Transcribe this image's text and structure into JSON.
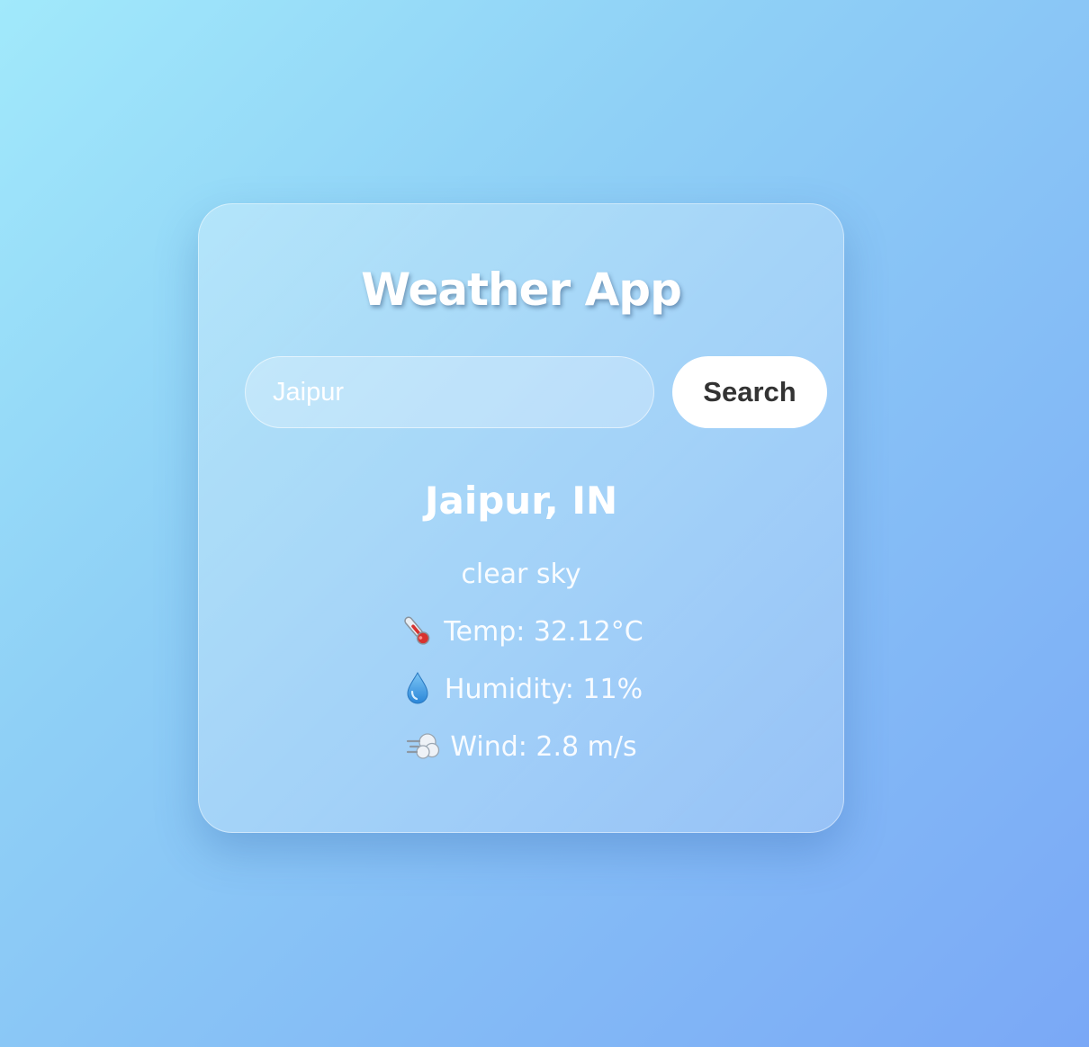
{
  "app": {
    "title": "Weather App"
  },
  "search": {
    "value": "Jaipur",
    "button_label": "Search"
  },
  "weather": {
    "location": "Jaipur, IN",
    "description": "clear sky",
    "temp_label": "Temp: 32.12°C",
    "humidity_label": "Humidity: 11%",
    "wind_label": "Wind: 2.8 m/s",
    "icons": {
      "temp": "thermometer-icon",
      "humidity": "droplet-icon",
      "wind": "wind-icon"
    }
  },
  "colors": {
    "background_start": "#a1e9fb",
    "background_end": "#7aa8f6",
    "button_bg": "#ffffff",
    "button_text": "#333333",
    "text": "#ffffff"
  }
}
